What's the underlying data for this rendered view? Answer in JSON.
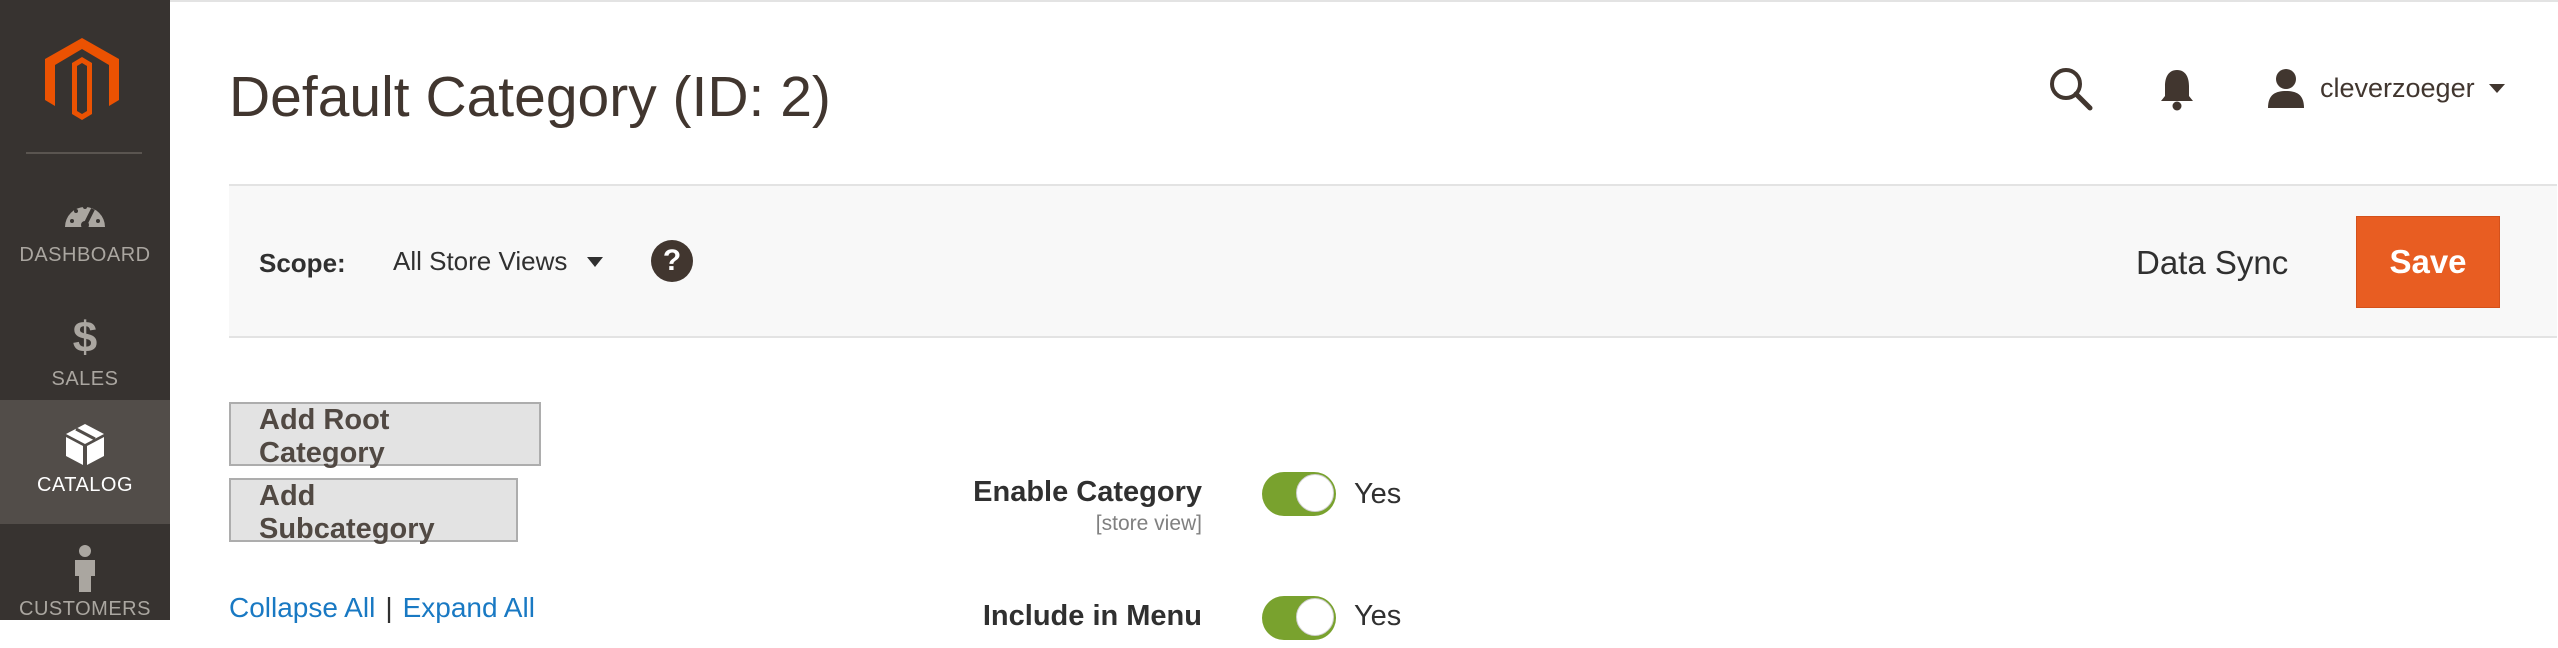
{
  "sidebar": {
    "items": [
      {
        "label": "DASHBOARD",
        "icon": "dashboard-icon"
      },
      {
        "label": "SALES",
        "icon": "dollar-icon"
      },
      {
        "label": "CATALOG",
        "icon": "box-icon"
      },
      {
        "label": "CUSTOMERS",
        "icon": "person-icon"
      }
    ],
    "active": "CATALOG"
  },
  "header": {
    "title": "Default Category (ID: 2)",
    "username": "cleverzoeger"
  },
  "scope_bar": {
    "label": "Scope:",
    "selected": "All Store Views",
    "help": "?",
    "data_sync_label": "Data Sync",
    "save_label": "Save"
  },
  "buttons": {
    "add_root": "Add Root Category",
    "add_sub": "Add Subcategory"
  },
  "tree_links": {
    "collapse": "Collapse All",
    "separator": "|",
    "expand": "Expand All"
  },
  "fields": [
    {
      "label": "Enable Category",
      "scope": "[store view]",
      "value": "Yes",
      "on": true
    },
    {
      "label": "Include in Menu",
      "value": "Yes",
      "on": true
    }
  ],
  "colors": {
    "sidebar_bg": "#373330",
    "sidebar_active": "#524d49",
    "accent": "#e85d22",
    "toggle_on": "#79a22e",
    "link": "#1979c3"
  }
}
